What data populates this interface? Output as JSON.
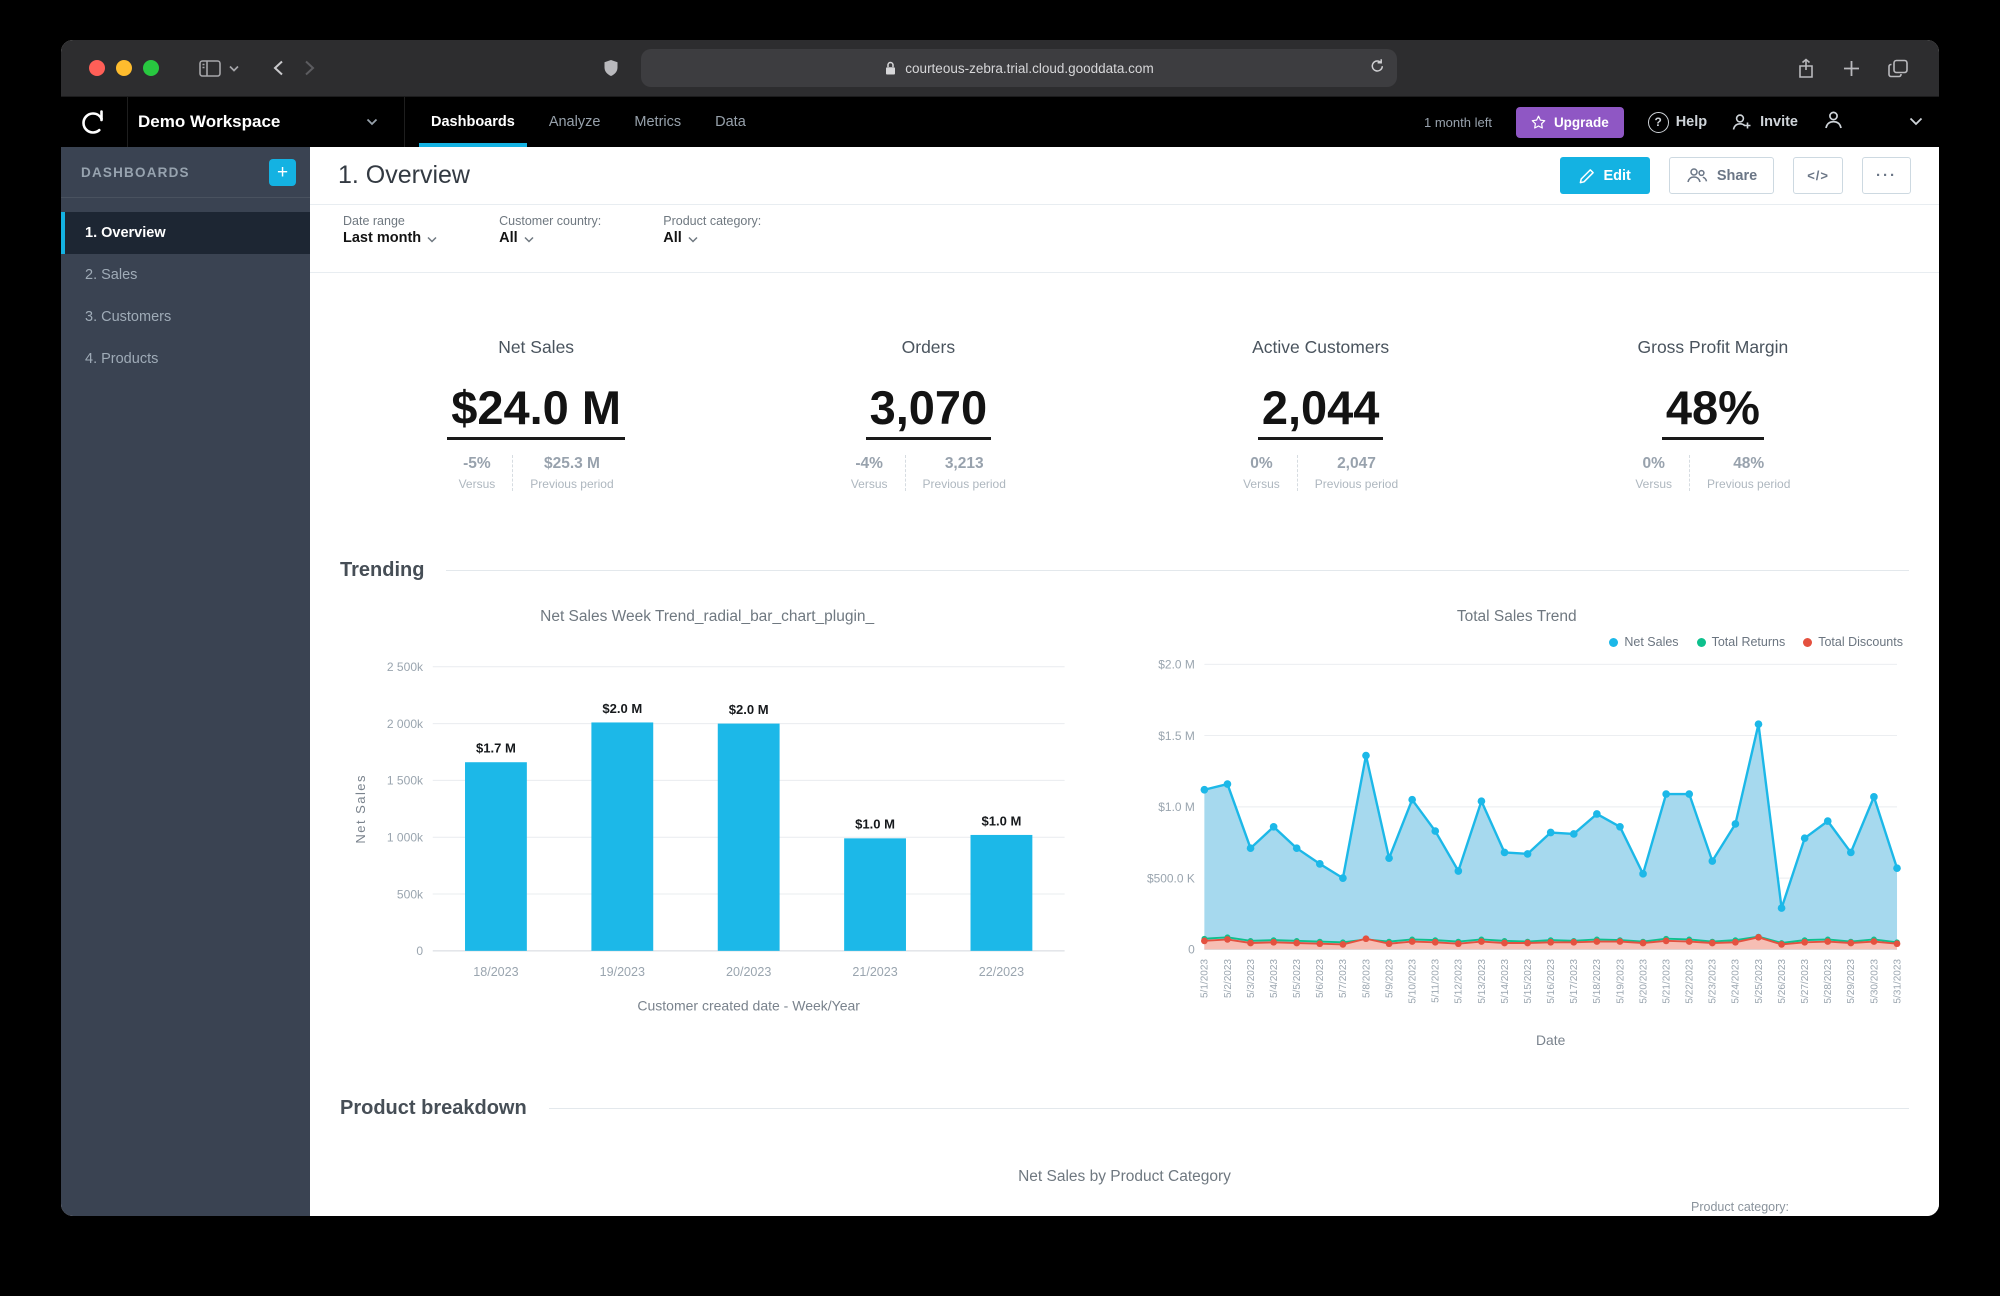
{
  "browser": {
    "url": "courteous-zebra.trial.cloud.gooddata.com"
  },
  "header": {
    "workspace": "Demo Workspace",
    "nav": [
      {
        "label": "Dashboards",
        "active": true
      },
      {
        "label": "Analyze",
        "active": false
      },
      {
        "label": "Metrics",
        "active": false
      },
      {
        "label": "Data",
        "active": false
      }
    ],
    "trial_left": "1 month left",
    "upgrade_label": "Upgrade",
    "help_label": "Help",
    "invite_label": "Invite"
  },
  "sidebar": {
    "title": "DASHBOARDS",
    "add_label": "+",
    "items": [
      {
        "label": "1. Overview",
        "active": true
      },
      {
        "label": "2. Sales",
        "active": false
      },
      {
        "label": "3. Customers",
        "active": false
      },
      {
        "label": "4. Products",
        "active": false
      }
    ]
  },
  "page": {
    "title": "1. Overview",
    "edit_label": "Edit",
    "share_label": "Share",
    "embed_label": "</>",
    "more_label": "···"
  },
  "filters": [
    {
      "label": "Date range",
      "value": "Last month"
    },
    {
      "label": "Customer country:",
      "value": "All"
    },
    {
      "label": "Product category:",
      "value": "All"
    }
  ],
  "kpis": [
    {
      "title": "Net Sales",
      "value": "$24.0 M",
      "change": "-5%",
      "change_label": "Versus",
      "previous": "$25.3 M",
      "previous_label": "Previous period"
    },
    {
      "title": "Orders",
      "value": "3,070",
      "change": "-4%",
      "change_label": "Versus",
      "previous": "3,213",
      "previous_label": "Previous period"
    },
    {
      "title": "Active Customers",
      "value": "2,044",
      "change": "0%",
      "change_label": "Versus",
      "previous": "2,047",
      "previous_label": "Previous period"
    },
    {
      "title": "Gross Profit Margin",
      "value": "48%",
      "change": "0%",
      "change_label": "Versus",
      "previous": "48%",
      "previous_label": "Previous period"
    }
  ],
  "sections": {
    "trending": "Trending",
    "product_breakdown": "Product breakdown",
    "product_breakdown_chart_title": "Net Sales by Product Category",
    "partial_filter_label": "Product category:"
  },
  "colors": {
    "accent": "#14b2e2",
    "upgrade_purple": "#8f57c4",
    "net_sales_blue": "#1cb8e8",
    "returns_green": "#0ec08d",
    "discounts_red": "#e4513f"
  },
  "chart_data": [
    {
      "type": "bar",
      "title": "Net Sales Week Trend_radial_bar_chart_plugin_",
      "categories": [
        "18/2023",
        "19/2023",
        "20/2023",
        "21/2023",
        "22/2023"
      ],
      "values": [
        1660000,
        2010000,
        2000000,
        990000,
        1020000
      ],
      "labels": [
        "$1.7 M",
        "$2.0 M",
        "$2.0 M",
        "$1.0 M",
        "$1.0 M"
      ],
      "xlabel": "Customer created date - Week/Year",
      "ylabel": "Net Sales",
      "ylim": [
        0,
        2500000
      ],
      "yticks": [
        0,
        500000,
        1000000,
        1500000,
        2000000,
        2500000
      ],
      "ytick_labels": [
        "0",
        "500k",
        "1 000k",
        "1 500k",
        "2 000k",
        "2 500k"
      ],
      "bar_color": "#1cb8e8",
      "grid": true
    },
    {
      "type": "area",
      "title": "Total Sales Trend",
      "xlabel": "Date",
      "ylim": [
        0,
        2000000
      ],
      "yticks": [
        0,
        500000,
        1000000,
        1500000,
        2000000
      ],
      "ytick_labels": [
        "0",
        "$500.0 K",
        "$1.0 M",
        "$1.5 M",
        "$2.0 M"
      ],
      "legend_position": "top-right",
      "grid": true,
      "x": [
        "5/1/2023",
        "5/2/2023",
        "5/3/2023",
        "5/4/2023",
        "5/5/2023",
        "5/6/2023",
        "5/7/2023",
        "5/8/2023",
        "5/9/2023",
        "5/10/2023",
        "5/11/2023",
        "5/12/2023",
        "5/13/2023",
        "5/14/2023",
        "5/15/2023",
        "5/16/2023",
        "5/17/2023",
        "5/18/2023",
        "5/19/2023",
        "5/20/2023",
        "5/21/2023",
        "5/22/2023",
        "5/23/2023",
        "5/24/2023",
        "5/25/2023",
        "5/26/2023",
        "5/27/2023",
        "5/28/2023",
        "5/29/2023",
        "5/30/2023",
        "5/31/2023"
      ],
      "series": [
        {
          "name": "Net Sales",
          "color": "#1cb8e8",
          "area_fill": "#a6d9ee",
          "values": [
            1120000,
            1160000,
            710000,
            860000,
            710000,
            600000,
            500000,
            1360000,
            640000,
            1050000,
            830000,
            550000,
            1040000,
            680000,
            670000,
            820000,
            810000,
            950000,
            860000,
            530000,
            1090000,
            1090000,
            620000,
            880000,
            1580000,
            290000,
            780000,
            900000,
            680000,
            1070000,
            570000
          ]
        },
        {
          "name": "Total Returns",
          "color": "#0ec08d",
          "area_fill": "",
          "values": [
            75000,
            85000,
            60000,
            65000,
            60000,
            55000,
            50000,
            70000,
            55000,
            70000,
            65000,
            55000,
            70000,
            60000,
            55000,
            65000,
            60000,
            70000,
            65000,
            55000,
            75000,
            70000,
            55000,
            65000,
            90000,
            45000,
            65000,
            70000,
            55000,
            70000,
            50000
          ]
        },
        {
          "name": "Total Discounts",
          "color": "#e4513f",
          "area_fill": "#f6beb4",
          "values": [
            60000,
            70000,
            45000,
            50000,
            45000,
            40000,
            35000,
            75000,
            40000,
            55000,
            50000,
            40000,
            55000,
            45000,
            45000,
            50000,
            50000,
            55000,
            55000,
            45000,
            60000,
            55000,
            45000,
            50000,
            85000,
            35000,
            50000,
            55000,
            45000,
            55000,
            40000
          ]
        }
      ]
    }
  ]
}
